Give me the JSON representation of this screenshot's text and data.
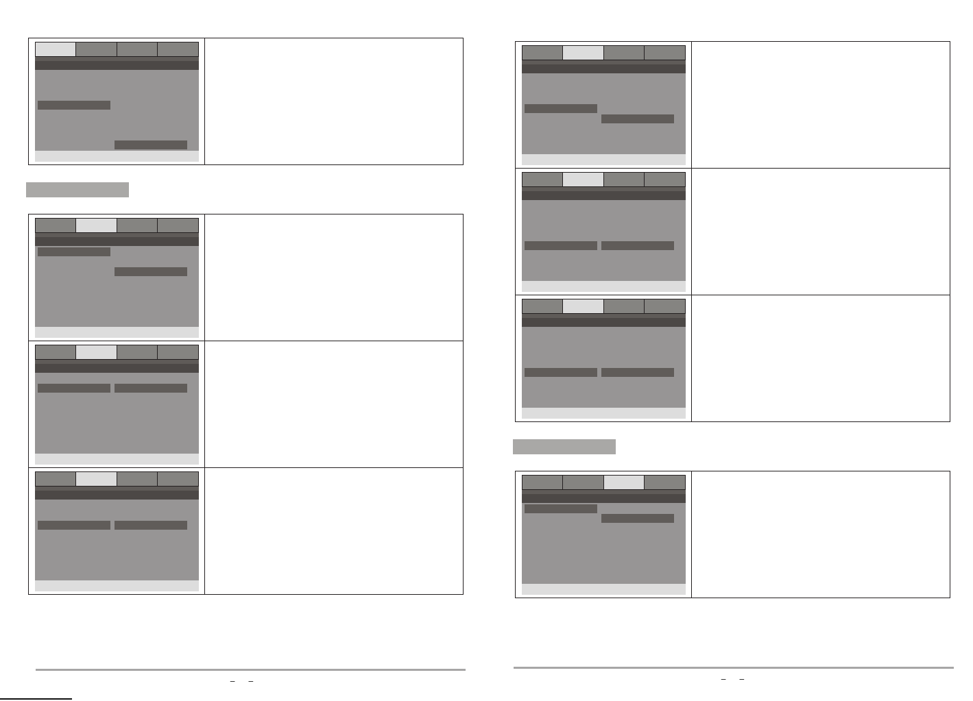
{
  "pages": [
    {
      "blocks": [
        {
          "kind": "table",
          "rows": [
            {
              "screen": {
                "tabs": [
                  {
                    "selected": true
                  },
                  {
                    "selected": false
                  },
                  {
                    "selected": false
                  },
                  {
                    "selected": false
                  }
                ],
                "menu_items": [
                  {
                    "selected": false
                  },
                  {
                    "selected": false
                  },
                  {
                    "selected": false
                  },
                  {
                    "selected": true
                  },
                  {
                    "selected": false
                  },
                  {
                    "selected": false
                  },
                  {
                    "selected": false
                  },
                  {
                    "selected": false
                  }
                ],
                "options": [
                  {
                    "selected": false
                  },
                  {
                    "selected": false
                  },
                  {
                    "selected": false
                  },
                  {
                    "selected": false
                  },
                  {
                    "selected": false
                  },
                  {
                    "selected": false
                  },
                  {
                    "selected": false
                  },
                  {
                    "selected": true
                  }
                ]
              }
            }
          ]
        },
        {
          "kind": "heading_bar"
        },
        {
          "kind": "table",
          "rows": [
            {
              "screen": {
                "tabs": [
                  {
                    "selected": false
                  },
                  {
                    "selected": true
                  },
                  {
                    "selected": false
                  },
                  {
                    "selected": false
                  }
                ],
                "menu_items": [
                  {
                    "selected": true
                  },
                  {
                    "selected": false
                  },
                  {
                    "selected": false
                  },
                  {
                    "selected": false
                  },
                  {
                    "selected": false
                  },
                  {
                    "selected": false
                  },
                  {
                    "selected": false
                  },
                  {
                    "selected": false
                  }
                ],
                "options": [
                  {
                    "selected": false
                  },
                  {
                    "selected": false
                  },
                  {
                    "selected": true
                  },
                  {
                    "selected": false
                  },
                  {
                    "selected": false
                  },
                  {
                    "selected": false
                  },
                  {
                    "selected": false
                  },
                  {
                    "selected": false
                  }
                ]
              }
            },
            {
              "screen": {
                "tabs": [
                  {
                    "selected": false
                  },
                  {
                    "selected": true
                  },
                  {
                    "selected": false
                  },
                  {
                    "selected": false
                  }
                ],
                "menu_items": [
                  {
                    "selected": false
                  },
                  {
                    "selected": true
                  },
                  {
                    "selected": false
                  },
                  {
                    "selected": false
                  },
                  {
                    "selected": false
                  },
                  {
                    "selected": false
                  },
                  {
                    "selected": false
                  },
                  {
                    "selected": false
                  }
                ],
                "options": [
                  {
                    "selected": false
                  },
                  {
                    "selected": true
                  },
                  {
                    "selected": false
                  },
                  {
                    "selected": false
                  },
                  {
                    "selected": false
                  },
                  {
                    "selected": false
                  },
                  {
                    "selected": false
                  },
                  {
                    "selected": false
                  }
                ]
              }
            },
            {
              "screen": {
                "tabs": [
                  {
                    "selected": false
                  },
                  {
                    "selected": true
                  },
                  {
                    "selected": false
                  },
                  {
                    "selected": false
                  }
                ],
                "menu_items": [
                  {
                    "selected": false
                  },
                  {
                    "selected": false
                  },
                  {
                    "selected": true
                  },
                  {
                    "selected": false
                  },
                  {
                    "selected": false
                  },
                  {
                    "selected": false
                  },
                  {
                    "selected": false
                  },
                  {
                    "selected": false
                  }
                ],
                "options": [
                  {
                    "selected": false
                  },
                  {
                    "selected": false
                  },
                  {
                    "selected": true
                  },
                  {
                    "selected": false
                  },
                  {
                    "selected": false
                  },
                  {
                    "selected": false
                  },
                  {
                    "selected": false
                  },
                  {
                    "selected": false
                  }
                ]
              }
            }
          ]
        }
      ],
      "page_marks": [
        "–",
        "–"
      ]
    },
    {
      "blocks": [
        {
          "kind": "table",
          "rows": [
            {
              "screen": {
                "tabs": [
                  {
                    "selected": false
                  },
                  {
                    "selected": true
                  },
                  {
                    "selected": false
                  },
                  {
                    "selected": false
                  }
                ],
                "menu_items": [
                  {
                    "selected": false
                  },
                  {
                    "selected": false
                  },
                  {
                    "selected": false
                  },
                  {
                    "selected": true
                  },
                  {
                    "selected": false
                  },
                  {
                    "selected": false
                  },
                  {
                    "selected": false
                  },
                  {
                    "selected": false
                  }
                ],
                "options": [
                  {
                    "selected": false
                  },
                  {
                    "selected": false
                  },
                  {
                    "selected": false
                  },
                  {
                    "selected": false
                  },
                  {
                    "selected": true
                  },
                  {
                    "selected": false
                  },
                  {
                    "selected": false
                  },
                  {
                    "selected": false
                  }
                ]
              }
            },
            {
              "screen": {
                "tabs": [
                  {
                    "selected": false
                  },
                  {
                    "selected": true
                  },
                  {
                    "selected": false
                  },
                  {
                    "selected": false
                  }
                ],
                "menu_items": [
                  {
                    "selected": false
                  },
                  {
                    "selected": false
                  },
                  {
                    "selected": false
                  },
                  {
                    "selected": false
                  },
                  {
                    "selected": true
                  },
                  {
                    "selected": false
                  },
                  {
                    "selected": false
                  },
                  {
                    "selected": false
                  }
                ],
                "options": [
                  {
                    "selected": false
                  },
                  {
                    "selected": false
                  },
                  {
                    "selected": false
                  },
                  {
                    "selected": false
                  },
                  {
                    "selected": true
                  },
                  {
                    "selected": false
                  },
                  {
                    "selected": false
                  },
                  {
                    "selected": false
                  }
                ]
              }
            },
            {
              "screen": {
                "tabs": [
                  {
                    "selected": false
                  },
                  {
                    "selected": true
                  },
                  {
                    "selected": false
                  },
                  {
                    "selected": false
                  }
                ],
                "menu_items": [
                  {
                    "selected": false
                  },
                  {
                    "selected": false
                  },
                  {
                    "selected": false
                  },
                  {
                    "selected": false
                  },
                  {
                    "selected": true
                  },
                  {
                    "selected": false
                  },
                  {
                    "selected": false
                  },
                  {
                    "selected": false
                  }
                ],
                "options": [
                  {
                    "selected": false
                  },
                  {
                    "selected": false
                  },
                  {
                    "selected": false
                  },
                  {
                    "selected": false
                  },
                  {
                    "selected": true
                  },
                  {
                    "selected": false
                  },
                  {
                    "selected": false
                  },
                  {
                    "selected": false
                  }
                ]
              }
            }
          ]
        },
        {
          "kind": "heading_bar"
        },
        {
          "kind": "table",
          "rows": [
            {
              "screen": {
                "tabs": [
                  {
                    "selected": false
                  },
                  {
                    "selected": false
                  },
                  {
                    "selected": true
                  },
                  {
                    "selected": false
                  }
                ],
                "menu_items": [
                  {
                    "selected": true
                  },
                  {
                    "selected": false
                  },
                  {
                    "selected": false
                  },
                  {
                    "selected": false
                  },
                  {
                    "selected": false
                  },
                  {
                    "selected": false
                  },
                  {
                    "selected": false
                  },
                  {
                    "selected": false
                  }
                ],
                "options": [
                  {
                    "selected": false
                  },
                  {
                    "selected": true
                  },
                  {
                    "selected": false
                  },
                  {
                    "selected": false
                  },
                  {
                    "selected": false
                  },
                  {
                    "selected": false
                  },
                  {
                    "selected": false
                  },
                  {
                    "selected": false
                  }
                ]
              }
            }
          ]
        }
      ],
      "page_marks": [
        "–",
        "–"
      ]
    }
  ]
}
